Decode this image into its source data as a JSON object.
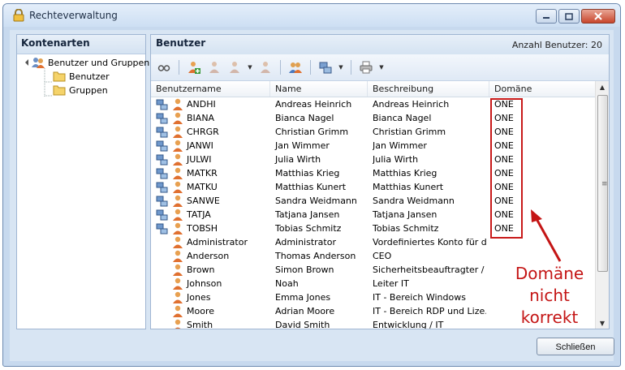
{
  "window": {
    "title": "Rechteverwaltung",
    "icon": "lock-icon",
    "close_button_label": "Schließen"
  },
  "left_panel": {
    "header": "Kontenarten",
    "tree": [
      {
        "label": "Benutzer und Gruppen",
        "icon": "users-groups-icon",
        "level": 0
      },
      {
        "label": "Benutzer",
        "icon": "folder-icon",
        "level": 1
      },
      {
        "label": "Gruppen",
        "icon": "folder-icon",
        "level": 1
      }
    ]
  },
  "right_panel": {
    "header": "Benutzer",
    "count_label": "Anzahl Benutzer: 20",
    "toolbar_icons": [
      "glasses-icon",
      "add-user-icon",
      "user-icon",
      "user-dropdown-icon",
      "user-remove-icon",
      "user-swap-icon",
      "network-user-icon",
      "printer-icon"
    ],
    "columns": [
      "Benutzername",
      "Name",
      "Beschreibung",
      "Domäne"
    ],
    "rows": [
      {
        "user": "ANDHI",
        "name": "Andreas Heinrich",
        "desc": "Andreas Heinrich",
        "domain": "ONE",
        "network": true
      },
      {
        "user": "BIANA",
        "name": "Bianca Nagel",
        "desc": "Bianca Nagel",
        "domain": "ONE",
        "network": true
      },
      {
        "user": "CHRGR",
        "name": "Christian Grimm",
        "desc": "Christian Grimm",
        "domain": "ONE",
        "network": true
      },
      {
        "user": "JANWI",
        "name": "Jan Wimmer",
        "desc": "Jan Wimmer",
        "domain": "ONE",
        "network": true
      },
      {
        "user": "JULWI",
        "name": "Julia Wirth",
        "desc": "Julia Wirth",
        "domain": "ONE",
        "network": true
      },
      {
        "user": "MATKR",
        "name": "Matthias Krieg",
        "desc": "Matthias Krieg",
        "domain": "ONE",
        "network": true
      },
      {
        "user": "MATKU",
        "name": "Matthias Kunert",
        "desc": "Matthias Kunert",
        "domain": "ONE",
        "network": true
      },
      {
        "user": "SANWE",
        "name": "Sandra Weidmann",
        "desc": "Sandra Weidmann",
        "domain": "ONE",
        "network": true
      },
      {
        "user": "TATJA",
        "name": "Tatjana Jansen",
        "desc": "Tatjana Jansen",
        "domain": "ONE",
        "network": true
      },
      {
        "user": "TOBSH",
        "name": "Tobias Schmitz",
        "desc": "Tobias Schmitz",
        "domain": "ONE",
        "network": true
      },
      {
        "user": "Administrator",
        "name": "Administrator",
        "desc": "Vordefiniertes Konto für die...",
        "domain": "",
        "network": false
      },
      {
        "user": "Anderson",
        "name": "Thomas Anderson",
        "desc": "CEO",
        "domain": "",
        "network": false
      },
      {
        "user": "Brown",
        "name": "Simon Brown",
        "desc": "Sicherheitsbeauftragter / ...",
        "domain": "",
        "network": false
      },
      {
        "user": "Johnson",
        "name": "Noah",
        "desc": "Leiter IT",
        "domain": "",
        "network": false
      },
      {
        "user": "Jones",
        "name": "Emma Jones",
        "desc": "IT - Bereich Windows",
        "domain": "",
        "network": false
      },
      {
        "user": "Moore",
        "name": "Adrian Moore",
        "desc": "IT - Bereich RDP und Lize...",
        "domain": "",
        "network": false
      },
      {
        "user": "Smith",
        "name": "David Smith",
        "desc": "Entwicklung / IT",
        "domain": "",
        "network": false
      }
    ]
  },
  "annotation": {
    "lines": [
      "Domäne",
      "nicht",
      "korrekt"
    ],
    "color": "#c41515"
  }
}
